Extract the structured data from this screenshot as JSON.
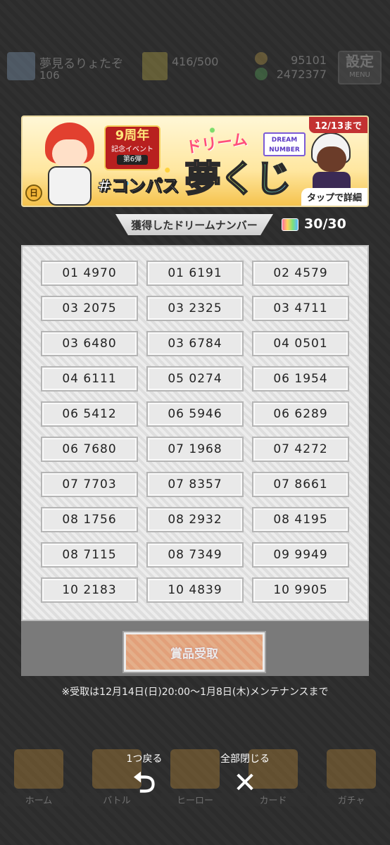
{
  "hud": {
    "player_name": "夢見るりょたぞ",
    "level": "106",
    "rank_value": "416/500",
    "coins": "95101",
    "points": "2472377",
    "settings_label": "設定",
    "settings_sub": "MENU"
  },
  "banner": {
    "anniversary": "9周年",
    "event_line": "記念イベント",
    "event_number": "第6弾",
    "hashtag": "#コンパス",
    "dream_text": "ドリーム",
    "title": "夢くじ",
    "dream_number_logo": "DREAM NUMBER",
    "until": "12/13まで",
    "detail": "タップで詳細",
    "coin_icon": "coin-icon"
  },
  "acquired": {
    "label": "獲得したドリームナンバー",
    "count": "30/30",
    "icon": "ticket-icon"
  },
  "numbers": [
    "01 4970",
    "01 6191",
    "02 4579",
    "03 2075",
    "03 2325",
    "03 4711",
    "03 6480",
    "03 6784",
    "04 0501",
    "04 6111",
    "05 0274",
    "06 1954",
    "06 5412",
    "06 5946",
    "06 6289",
    "06 7680",
    "07 1968",
    "07 4272",
    "07 7703",
    "07 8357",
    "07 8661",
    "08 1756",
    "08 2932",
    "08 4195",
    "08 7115",
    "08 7349",
    "09 9949",
    "10 2183",
    "10 4839",
    "10 9905"
  ],
  "receive_button": "賞品受取",
  "notice": "※受取は12月14日(日)20:00～1月8日(木)メンテナンスまで",
  "controls": {
    "back_label": "1つ戻る",
    "back_icon": "return-arrow-icon",
    "close_all_label": "全部閉じる",
    "close_icon": "close-icon"
  },
  "bottom_nav": [
    {
      "label": "ホーム"
    },
    {
      "label": "バトル"
    },
    {
      "label": "ヒーロー"
    },
    {
      "label": "カード"
    },
    {
      "label": "ガチャ"
    }
  ]
}
